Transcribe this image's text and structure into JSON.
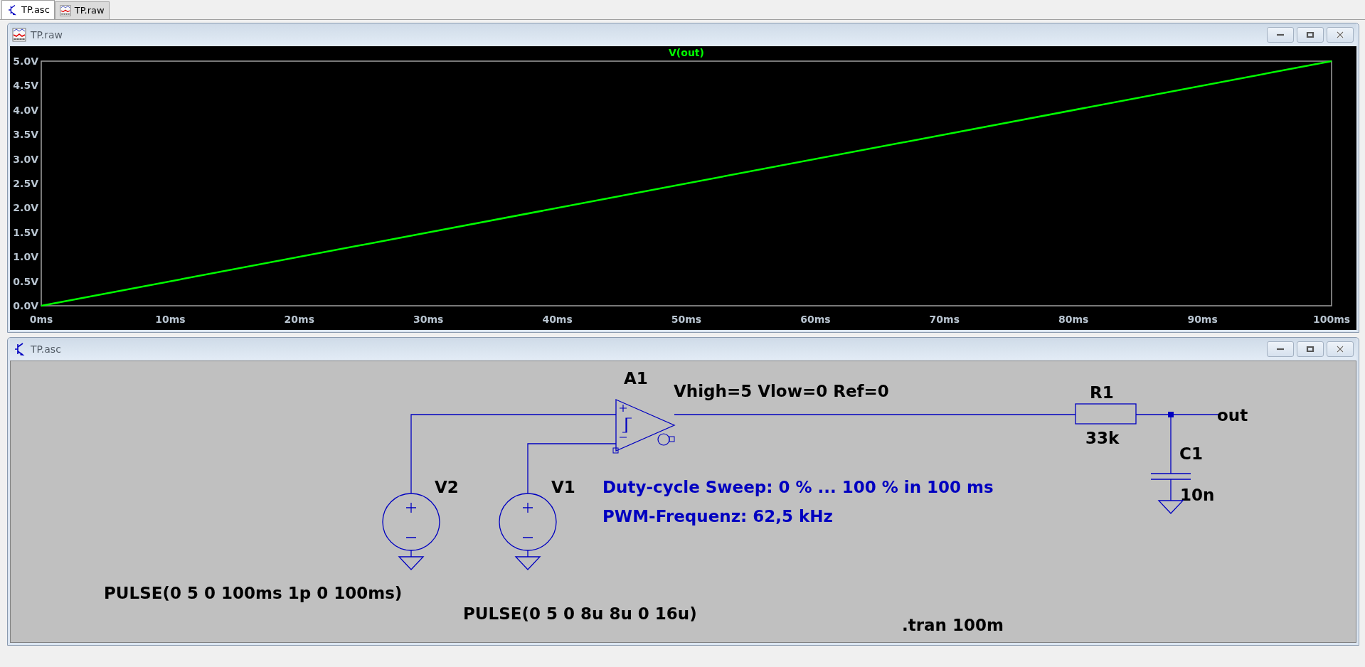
{
  "tabs": [
    {
      "label": "TP.asc",
      "kind": "schematic",
      "selected": true
    },
    {
      "label": "TP.raw",
      "kind": "waveform",
      "selected": false
    }
  ],
  "waveform_window": {
    "title": "TP.raw",
    "kind": "waveform",
    "chart_data": {
      "type": "line",
      "title": "V(out)",
      "x": [
        0,
        100
      ],
      "xlim": [
        0,
        100
      ],
      "ylim": [
        0,
        5
      ],
      "series": [
        {
          "color": "#00ff00",
          "values": [
            0,
            5
          ]
        }
      ],
      "xticks": [
        {
          "value": 0,
          "label": "0ms"
        },
        {
          "value": 10,
          "label": "10ms"
        },
        {
          "value": 20,
          "label": "20ms"
        },
        {
          "value": 30,
          "label": "30ms"
        },
        {
          "value": 40,
          "label": "40ms"
        },
        {
          "value": 50,
          "label": "50ms"
        },
        {
          "value": 60,
          "label": "60ms"
        },
        {
          "value": 70,
          "label": "70ms"
        },
        {
          "value": 80,
          "label": "80ms"
        },
        {
          "value": 90,
          "label": "90ms"
        },
        {
          "value": 100,
          "label": "100ms"
        }
      ],
      "yticks": [
        {
          "value": 0,
          "label": "0.0V"
        },
        {
          "value": 0.5,
          "label": "0.5V"
        },
        {
          "value": 1,
          "label": "1.0V"
        },
        {
          "value": 1.5,
          "label": "1.5V"
        },
        {
          "value": 2,
          "label": "2.0V"
        },
        {
          "value": 2.5,
          "label": "2.5V"
        },
        {
          "value": 3,
          "label": "3.0V"
        },
        {
          "value": 3.5,
          "label": "3.5V"
        },
        {
          "value": 4,
          "label": "4.0V"
        },
        {
          "value": 4.5,
          "label": "4.5V"
        },
        {
          "value": 5,
          "label": "5.0V"
        }
      ]
    }
  },
  "schematic_window": {
    "title": "TP.asc",
    "kind": "schematic",
    "components": [
      {
        "kind": "comparator",
        "ref": "A1",
        "value": "Vhigh=5 Vlow=0 Ref=0"
      },
      {
        "kind": "resistor",
        "ref": "R1",
        "value": "33k"
      },
      {
        "kind": "capacitor",
        "ref": "C1",
        "value": "10n"
      },
      {
        "kind": "voltage_source",
        "ref": "V2",
        "value": "PULSE(0 5 0 100ms 1p 0 100ms)"
      },
      {
        "kind": "voltage_source",
        "ref": "V1",
        "value": "PULSE(0 5 0 8u 8u 0 16u)"
      }
    ],
    "net_labels": [
      "out"
    ],
    "comments": [
      "Duty-cycle Sweep: 0 % ... 100 % in 100 ms",
      "PWM-Frequenz: 62,5 kHz"
    ],
    "directives": [
      ".tran 100m"
    ]
  }
}
